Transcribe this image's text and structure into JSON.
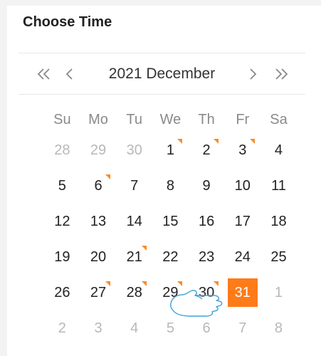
{
  "panel": {
    "title": "Choose Time"
  },
  "calendar": {
    "month_label": "2021 December",
    "weekdays": [
      "Su",
      "Mo",
      "Tu",
      "We",
      "Th",
      "Fr",
      "Sa"
    ],
    "weeks": [
      [
        {
          "d": "28",
          "muted": true
        },
        {
          "d": "29",
          "muted": true
        },
        {
          "d": "30",
          "muted": true
        },
        {
          "d": "1",
          "mark": true
        },
        {
          "d": "2",
          "mark": true
        },
        {
          "d": "3",
          "mark": true
        },
        {
          "d": "4"
        }
      ],
      [
        {
          "d": "5"
        },
        {
          "d": "6",
          "mark": true
        },
        {
          "d": "7"
        },
        {
          "d": "8"
        },
        {
          "d": "9"
        },
        {
          "d": "10"
        },
        {
          "d": "11"
        }
      ],
      [
        {
          "d": "12"
        },
        {
          "d": "13"
        },
        {
          "d": "14"
        },
        {
          "d": "15"
        },
        {
          "d": "16"
        },
        {
          "d": "17"
        },
        {
          "d": "18"
        }
      ],
      [
        {
          "d": "19"
        },
        {
          "d": "20"
        },
        {
          "d": "21",
          "mark": true
        },
        {
          "d": "22"
        },
        {
          "d": "23"
        },
        {
          "d": "24"
        },
        {
          "d": "25"
        }
      ],
      [
        {
          "d": "26"
        },
        {
          "d": "27",
          "mark": true
        },
        {
          "d": "28",
          "mark": true
        },
        {
          "d": "29",
          "mark": true
        },
        {
          "d": "30",
          "mark": true
        },
        {
          "d": "31",
          "selected": true
        },
        {
          "d": "1",
          "muted": true
        }
      ],
      [
        {
          "d": "2",
          "muted": true
        },
        {
          "d": "3",
          "muted": true
        },
        {
          "d": "4",
          "muted": true
        },
        {
          "d": "5",
          "muted": true
        },
        {
          "d": "6",
          "muted": true
        },
        {
          "d": "7",
          "muted": true
        },
        {
          "d": "8",
          "muted": true
        }
      ]
    ],
    "selected_day": "31"
  },
  "colors": {
    "accent": "#ff7a18",
    "mark": "#ff8a20",
    "muted": "#b8b8b8"
  },
  "icons": {
    "prev_year": "double-chevron-left-icon",
    "prev_month": "chevron-left-icon",
    "next_month": "chevron-right-icon",
    "next_year": "double-chevron-right-icon",
    "cursor": "hand-pointer-icon"
  }
}
